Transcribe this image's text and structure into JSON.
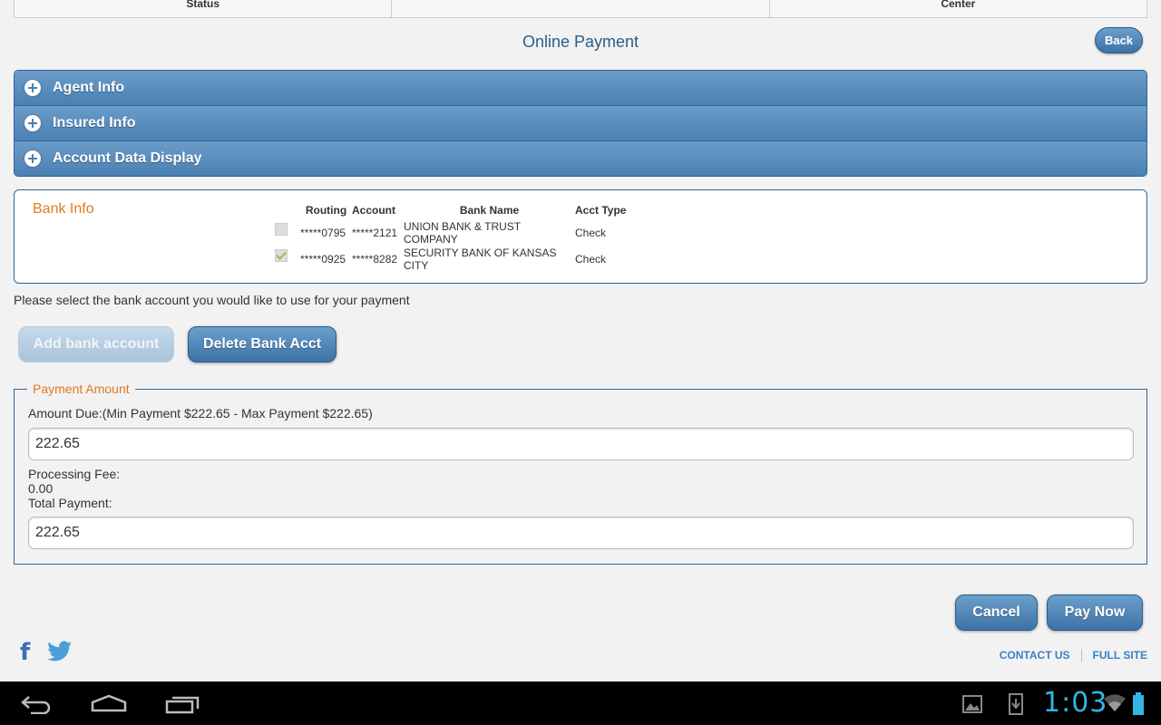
{
  "top_tabs": [
    "Status",
    "",
    "Center"
  ],
  "page_title": "Online Payment",
  "back_label": "Back",
  "accordion": [
    {
      "label": "Agent Info"
    },
    {
      "label": "Insured Info"
    },
    {
      "label": "Account Data Display"
    }
  ],
  "bank_info": {
    "title": "Bank Info",
    "headers": {
      "routing": "Routing",
      "account": "Account",
      "bank_name": "Bank Name",
      "acct_type": "Acct Type"
    },
    "rows": [
      {
        "routing": "*****0795",
        "account": "*****2121",
        "bank_name": "UNION BANK & TRUST COMPANY",
        "acct_type": "Check",
        "checked": false
      },
      {
        "routing": "*****0925",
        "account": "*****8282",
        "bank_name": "SECURITY BANK OF KANSAS CITY",
        "acct_type": "Check",
        "checked": true
      }
    ]
  },
  "select_message": "Please select the bank account you would like to use for your payment",
  "buttons": {
    "add_bank": "Add bank account",
    "delete_bank": "Delete Bank Acct",
    "cancel": "Cancel",
    "pay_now": "Pay Now"
  },
  "payment": {
    "legend": "Payment Amount",
    "amount_due_label": "Amount Due:(Min Payment $222.65 - Max Payment $222.65)",
    "amount_value": "222.65",
    "processing_fee_label": "Processing Fee:",
    "processing_fee_value": "0.00",
    "total_label": "Total Payment:",
    "total_value": "222.65"
  },
  "footer": {
    "contact": "CONTACT US",
    "full_site": "FULL SITE"
  },
  "system_bar": {
    "time": "1:03",
    "accent": "#33b5e5",
    "icons": [
      "back-icon",
      "home-icon",
      "recent-apps-icon",
      "gallery-icon",
      "download-icon",
      "wifi-icon",
      "battery-icon"
    ]
  }
}
